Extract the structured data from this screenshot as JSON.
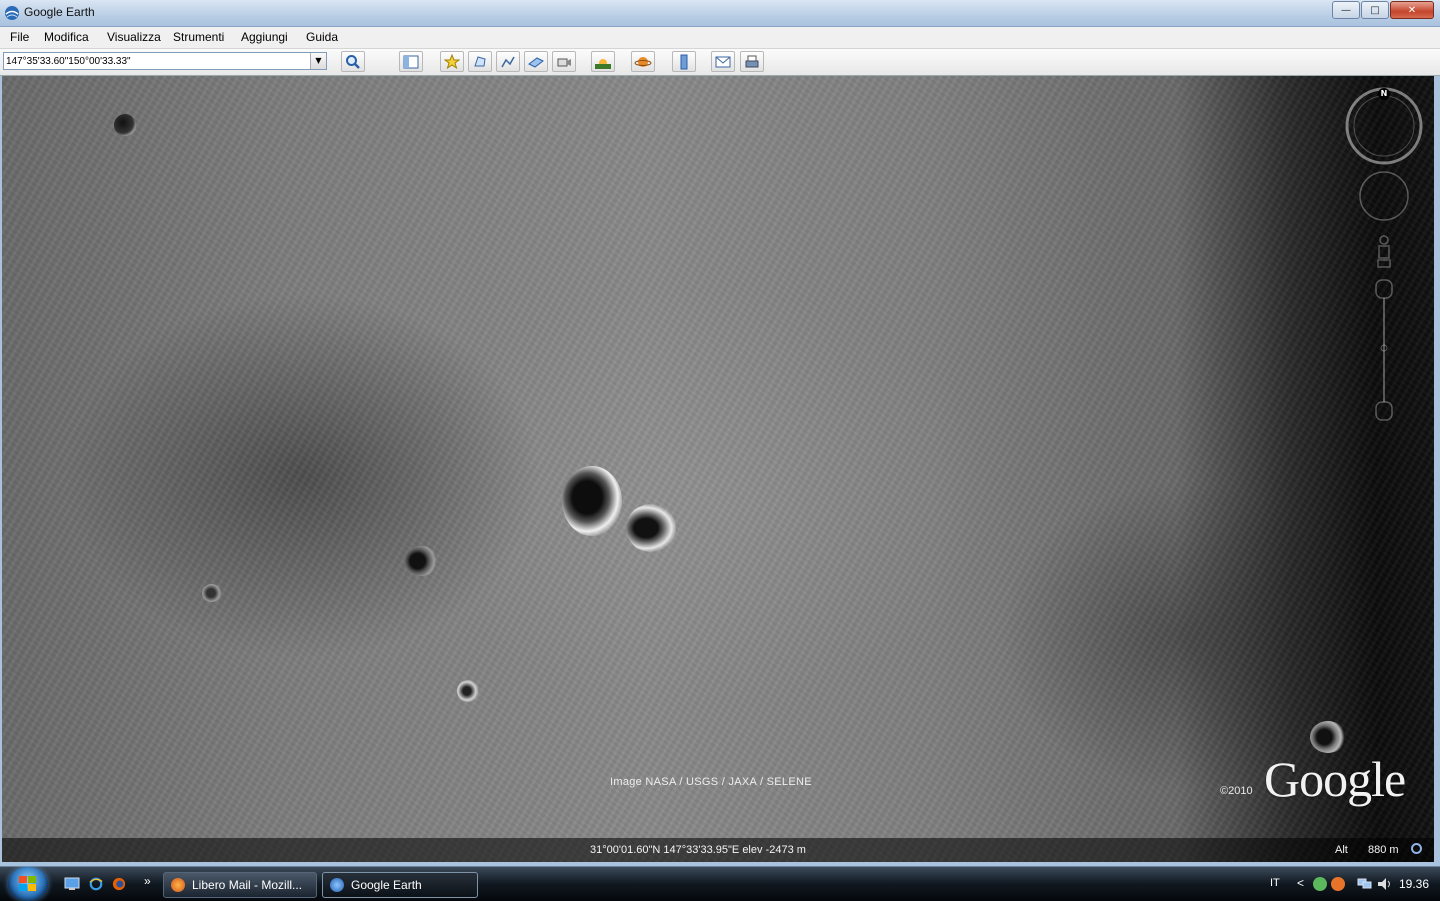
{
  "window": {
    "title": "Google Earth",
    "minimize_glyph": "—",
    "maximize_glyph": "□",
    "close_glyph": "✕"
  },
  "menu": [
    "File",
    "Modifica",
    "Visualizza",
    "Strumenti",
    "Aggiungi",
    "Guida"
  ],
  "search": {
    "value": "147°35'33.60\"150°00'33.33\""
  },
  "toolbar_icons": [
    "sidebar-toggle-icon",
    "placemark-icon",
    "polygon-icon",
    "path-icon",
    "image-overlay-icon",
    "record-tour-icon",
    "sunlight-icon",
    "planet-switch-icon",
    "ruler-icon",
    "email-icon",
    "print-icon"
  ],
  "map": {
    "attribution": "Image NASA / USGS / JAXA / SELENE",
    "copyright": "©2010",
    "logo_text": "Google",
    "compass_north": "N"
  },
  "status": {
    "coordinates": "31°00'01.60\"N  147°33'33.95\"E  elev -2473 m",
    "alt_label": "Alt",
    "alt_value": "880 m"
  },
  "taskbar": {
    "tasks": [
      {
        "label": "Libero Mail - Mozill...",
        "active": false
      },
      {
        "label": "Google Earth",
        "active": true
      }
    ],
    "language": "IT",
    "tray_expand_glyph": "<",
    "quick_launch_more": "»",
    "clock": "19.36"
  },
  "colors": {
    "accent": "#2a71b8",
    "titlebar": "#bcd0e6"
  }
}
